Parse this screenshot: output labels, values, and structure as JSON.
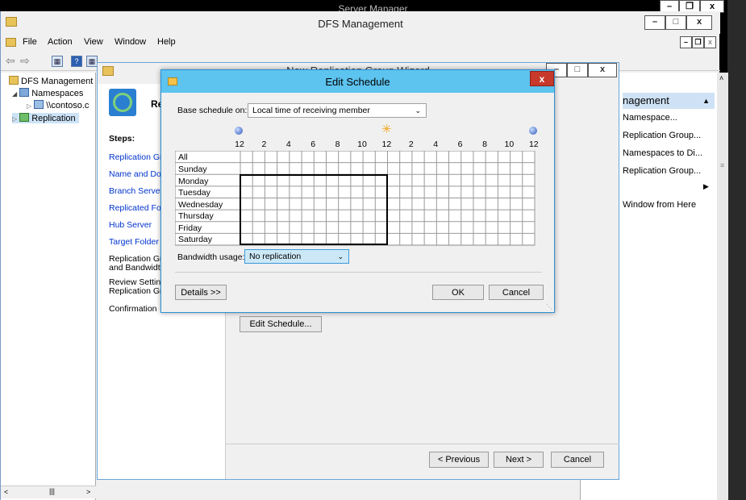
{
  "server_manager": {
    "title": "Server Manager"
  },
  "dfs_window": {
    "title": "DFS Management",
    "menu": [
      "File",
      "Action",
      "View",
      "Window",
      "Help"
    ],
    "tree": [
      {
        "label": "DFS Management",
        "icon": "dfs-management-icon"
      },
      {
        "label": "Namespaces",
        "icon": "namespaces-icon"
      },
      {
        "label": "\\\\contoso.c",
        "icon": "namespace-icon"
      },
      {
        "label": "Replication",
        "icon": "replication-icon"
      }
    ],
    "actions": {
      "header": "nagement",
      "items": [
        "Namespace...",
        "Replication Group...",
        "Namespaces to Di...",
        "Replication Group...",
        "Window from Here"
      ]
    }
  },
  "wizard": {
    "title": "New Replication Group Wizard",
    "header_text": "Re",
    "steps_label": "Steps:",
    "steps": [
      {
        "label": "Replication Gro",
        "link": true
      },
      {
        "label": "Name and Dom",
        "link": true
      },
      {
        "label": "Branch Server",
        "link": true
      },
      {
        "label": "Replicated Fold",
        "link": true
      },
      {
        "label": "Hub Server",
        "link": true
      },
      {
        "label": "Target Folder o",
        "link": true
      },
      {
        "label": "Replication Gro",
        "label2": "and Bandwidth",
        "link": false
      },
      {
        "label": "Review Setting",
        "label2": "Replication Gro",
        "link": false
      },
      {
        "label": "Confirmation",
        "link": false
      }
    ],
    "edit_schedule_button": "Edit Schedule...",
    "previous_button": "< Previous",
    "next_button": "Next >",
    "cancel_button": "Cancel"
  },
  "schedule_dialog": {
    "title": "Edit Schedule",
    "base_schedule_label": "Base schedule on:",
    "base_schedule_value": "Local time of receiving member",
    "hour_labels": [
      "12",
      "2",
      "4",
      "6",
      "8",
      "10",
      "12",
      "2",
      "4",
      "6",
      "8",
      "10",
      "12"
    ],
    "all_label": "All",
    "days": [
      "Sunday",
      "Monday",
      "Tuesday",
      "Wednesday",
      "Thursday",
      "Friday",
      "Saturday"
    ],
    "bandwidth_label": "Bandwidth usage:",
    "bandwidth_value": "No replication",
    "details_button": "Details >>",
    "ok_button": "OK",
    "cancel_button": "Cancel",
    "close_label": "x"
  }
}
